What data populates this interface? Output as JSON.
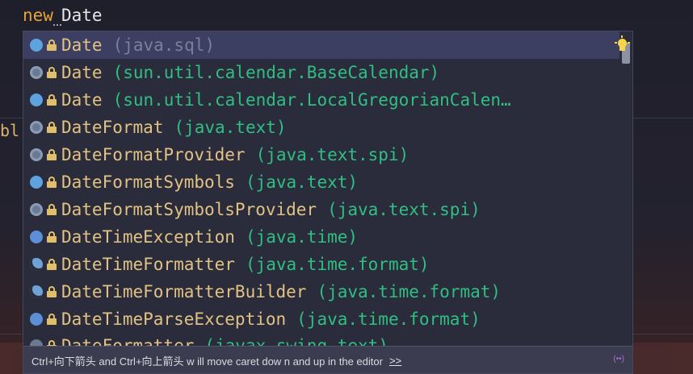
{
  "editor": {
    "keyword": "new",
    "identifier": "Date",
    "gutter_fragment": "bl"
  },
  "popup": {
    "items": [
      {
        "name": "Date",
        "package": "(java.sql)",
        "kind": "class",
        "selected": true
      },
      {
        "name": "Date",
        "package": "(sun.util.calendar.BaseCalendar)",
        "kind": "abstract"
      },
      {
        "name": "Date",
        "package": "(sun.util.calendar.LocalGregorianCalen…",
        "kind": "class"
      },
      {
        "name": "DateFormat",
        "package": "(java.text)",
        "kind": "abstract"
      },
      {
        "name": "DateFormatProvider",
        "package": "(java.text.spi)",
        "kind": "abstract"
      },
      {
        "name": "DateFormatSymbols",
        "package": "(java.text)",
        "kind": "class"
      },
      {
        "name": "DateFormatSymbolsProvider",
        "package": "(java.text.spi)",
        "kind": "abstract"
      },
      {
        "name": "DateTimeException",
        "package": "(java.time)",
        "kind": "exception"
      },
      {
        "name": "DateTimeFormatter",
        "package": "(java.time.format)",
        "kind": "final-class"
      },
      {
        "name": "DateTimeFormatterBuilder",
        "package": "(java.time.format)",
        "kind": "final-class"
      },
      {
        "name": "DateTimeParseException",
        "package": "(java.time.format)",
        "kind": "exception"
      }
    ],
    "partial_item": {
      "name": "DateFormatter",
      "package": "(javax.swing.text)"
    },
    "hint_icon": "lightbulb-icon",
    "footer": {
      "text": "Ctrl+向下箭头 and Ctrl+向上箭头 w ill move caret dow n and up in the editor",
      "link": ">>",
      "corner_icon": "(••)"
    }
  },
  "colors": {
    "name": "#e2c284",
    "package": "#2fbf83",
    "selection": "#3c3f62",
    "keyword": "#e5a13a"
  }
}
